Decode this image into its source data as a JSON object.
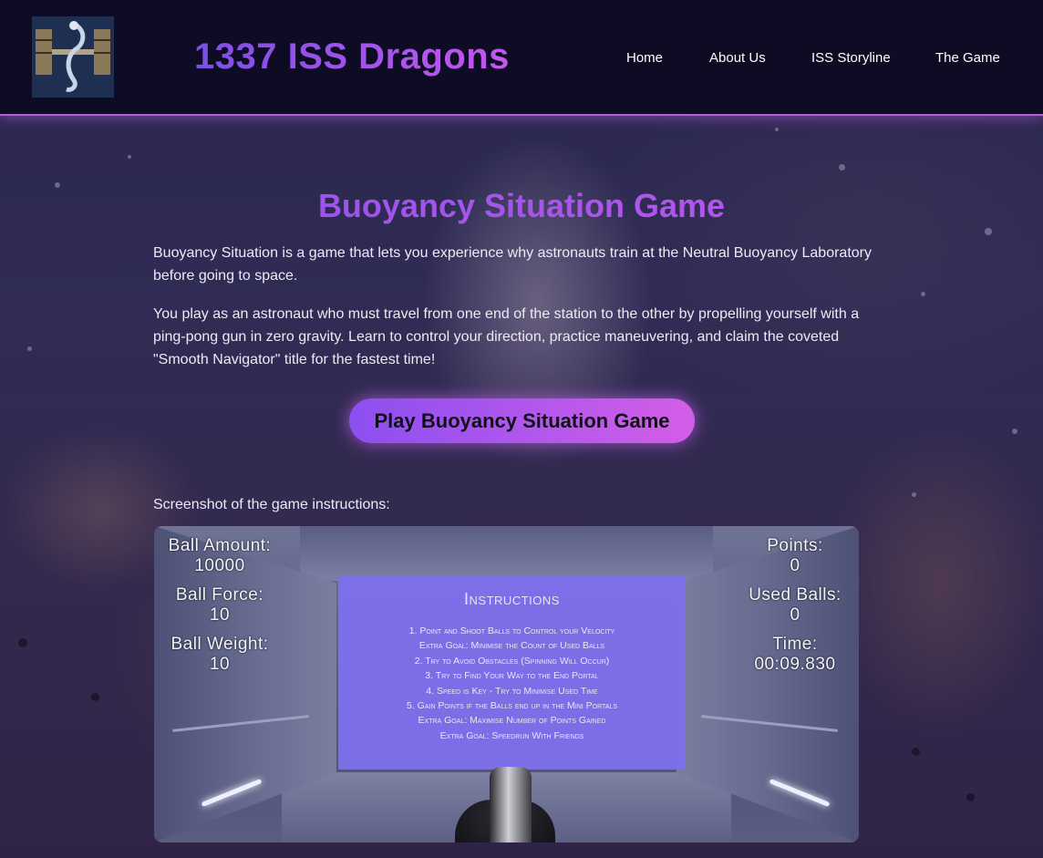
{
  "header": {
    "site_title": "1337 ISS Dragons",
    "nav": [
      {
        "label": "Home"
      },
      {
        "label": "About Us"
      },
      {
        "label": "ISS Storyline"
      },
      {
        "label": "The Game"
      }
    ]
  },
  "main": {
    "title": "Buoyancy Situation Game",
    "paragraph_1": "Buoyancy Situation is a game that lets you experience why astronauts train at the Neutral Buoyancy Laboratory before going to space.",
    "paragraph_2": "You play as an astronaut who must travel from one end of the station to the other by propelling yourself with a ping-pong gun in zero gravity. Learn to control your direction, practice maneuvering, and claim the coveted \"Smooth Navigator\" title for the fastest time!",
    "play_button": "Play Buoyancy Situation Game",
    "screenshot_caption": "Screenshot of the game instructions:"
  },
  "game_screenshot": {
    "ball_amount_label": "Ball Amount:",
    "ball_amount_value": "10000",
    "ball_force_label": "Ball Force:",
    "ball_force_value": "10",
    "ball_weight_label": "Ball Weight:",
    "ball_weight_value": "10",
    "points_label": "Points:",
    "points_value": "0",
    "used_balls_label": "Used Balls:",
    "used_balls_value": "0",
    "time_label": "Time:",
    "time_value": "00:09.830",
    "instructions_title": "Instructions",
    "instructions": [
      "1. Point and Shoot Balls to Control your Velocity",
      "Extra Goal: Minimise the Count of Used Balls",
      "2. Try to Avoid Obstacles (Spinning Will Occur)",
      "3. Try to Find Your Way to the End Portal",
      "4. Speed is Key - Try to Minimise Used Time",
      "5. Gain Points if the Balls end up in the Mini Portals",
      "Extra Goal: Maximise Number of Points Gained",
      "Extra Goal: Speedrun With Friends"
    ]
  },
  "colors": {
    "accent_purple": "#a552ea",
    "header_bg": "#0e0c24",
    "button_gradient_start": "#8c4ff0",
    "button_gradient_end": "#d35ee8",
    "instructions_panel": "#7e70ec"
  },
  "icons": {
    "logo": "iss-dragon-logo"
  }
}
